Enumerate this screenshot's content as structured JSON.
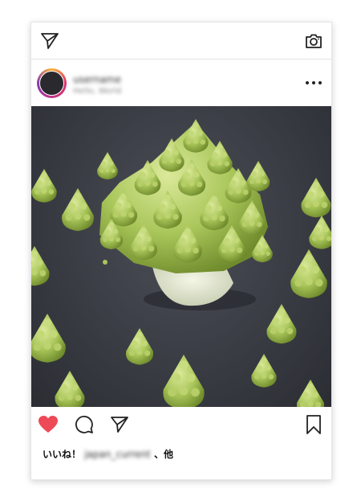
{
  "topbar": {
    "left_icon": "send-icon",
    "right_icon": "camera-icon"
  },
  "post": {
    "username": "username",
    "location": "Hello, World",
    "more_icon": "more-horizontal-icon",
    "photo_subject": "romanesco"
  },
  "actions": {
    "like_icon": "heart-icon",
    "comment_icon": "comment-icon",
    "share_icon": "send-icon",
    "save_icon": "bookmark-icon"
  },
  "likes": {
    "prefix": "いいね！",
    "liked_by": "japan_current",
    "suffix": "、他"
  },
  "colors": {
    "heart": "#ed4956",
    "photo_bg": "#3a3c44",
    "romanesco": "#a9c65a"
  }
}
